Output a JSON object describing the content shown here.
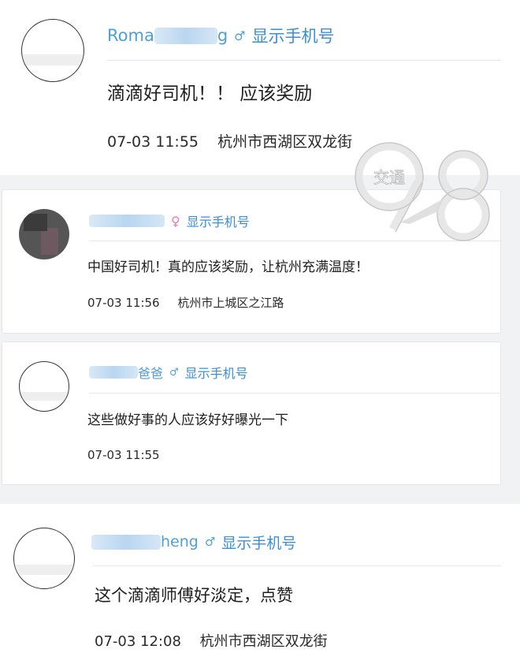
{
  "comments": [
    {
      "name_prefix": "Roma",
      "name_suffix": "g",
      "gender_icon": "♂",
      "phone_link": "显示手机号",
      "content": "滴滴好司机！！ 应该奖励",
      "time": "07-03 11:55",
      "location": "杭州市西湖区双龙街"
    },
    {
      "name_prefix": "",
      "name_suffix": "",
      "gender_icon": "♀",
      "phone_link": "显示手机号",
      "content": "中国好司机！真的应该奖励，让杭州充满温度！",
      "time": "07-03 11:56",
      "location": "杭州市上城区之江路"
    },
    {
      "name_prefix": "",
      "name_suffix": "爸爸",
      "gender_icon": "♂",
      "phone_link": "显示手机号",
      "content": "这些做好事的人应该好好曝光一下",
      "time": "07-03 11:55",
      "location": ""
    },
    {
      "name_prefix": "",
      "name_suffix": "heng",
      "gender_icon": "♂",
      "phone_link": "显示手机号",
      "content": "这个滴滴师傅好淡定，点赞",
      "time": "07-03 12:08",
      "location": "杭州市西湖区双龙街"
    }
  ],
  "watermark": {
    "badge": "交通",
    "number": "91.8"
  },
  "colors": {
    "name": "#4f9fd8",
    "phone_link": "#3b8fd6",
    "female": "#f07ab0",
    "background": "#f1f2f4"
  }
}
